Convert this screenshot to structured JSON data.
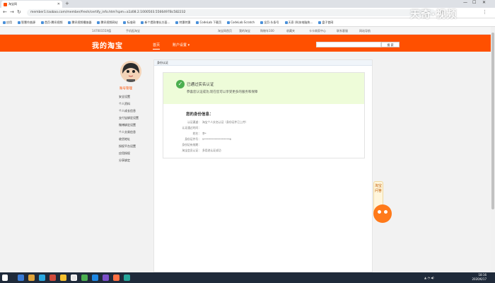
{
  "browser": {
    "tab_title": "淘宝网",
    "new_tab": "+",
    "url": "member1.taobao.com/member/fresh/certify_info.htm?spm=a1z08.2.1000503.5566497Bc582232",
    "bookmarks": [
      "应用",
      "智慧作曲源",
      "首页-腾讯视频",
      "腾讯视频播放器",
      "腾讯视频网站",
      "标准网",
      "新个提款增长方面…",
      "特惠特惠",
      "CodeLab 下载页",
      "CodeLab Scratch",
      "全页-头条号",
      "天奇 (科技电脑热…",
      "盘子首网"
    ]
  },
  "sitebar": {
    "left_user": "14700155X值",
    "mobile": "手机逛淘宝",
    "links": [
      "淘宝网首页",
      "我的淘宝",
      "购物车100",
      "收藏夹",
      "卡卡商家中心",
      "联系客服",
      "网站导航"
    ]
  },
  "header": {
    "logo": "我的淘宝",
    "nav_home": "首页",
    "nav_settings": "账户设置",
    "search_button": "搜 索"
  },
  "sidebar": {
    "username": "账号管理",
    "items": [
      "安全设置",
      "个人资料",
      "个人成长信息",
      "支付宝绑定设置",
      "微博绑定设置",
      "个人交易信息",
      "收货地址",
      "授权平台设置",
      "应用授权",
      "分享绑定"
    ]
  },
  "main": {
    "panel_title": "身份认证",
    "success_title": "已通过实名认证",
    "success_sub": "恭喜您认证成功,现在您可以享受更多的服务和保障",
    "info_title": "您的身份信息：",
    "info_rows": [
      {
        "label": "认证渠道：",
        "value": "淘宝个人实名认证（身份证件已上传）"
      },
      {
        "label": "认证通过时间：",
        "value": ""
      },
      {
        "label": "姓名：",
        "value": "李*"
      },
      {
        "label": "身份证件号：",
        "value": "5*******************6"
      },
      {
        "label": "身份证有效期：",
        "value": ""
      },
      {
        "label": "淘宝会员认证：",
        "value": "多用途认证成功"
      }
    ]
  },
  "float": {
    "label": "淘宝问答"
  },
  "watermark": "天奇·视频",
  "taskbar": {
    "time": "18:16",
    "date": "2020/6/17"
  },
  "colors": {
    "brand": "#ff5000",
    "success_bg": "#eefcd9",
    "check": "#4caf50"
  }
}
